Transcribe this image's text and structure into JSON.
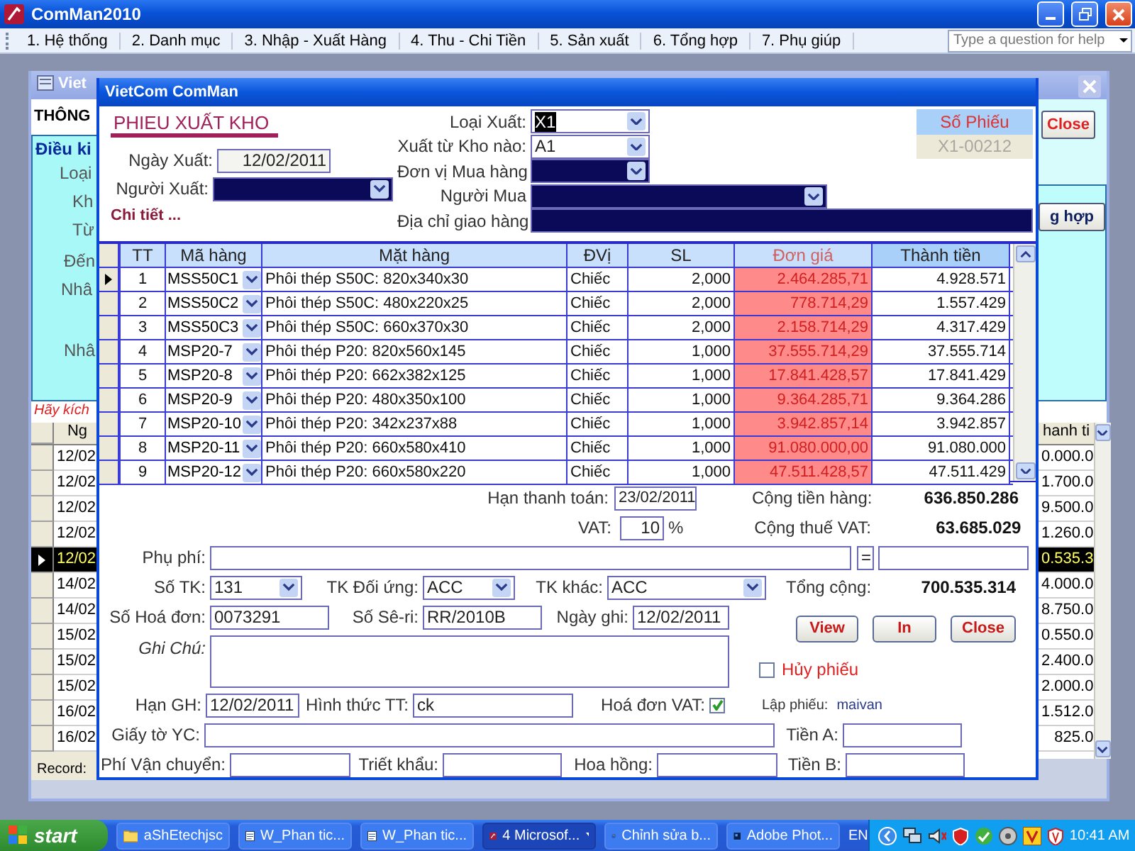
{
  "app": {
    "title": "ComMan2010",
    "menu": [
      "1. Hệ thống",
      "2. Danh mục",
      "3. Nhập - Xuất Hàng",
      "4. Thu - Chi Tiền",
      "5. Sản xuất",
      "6. Tổng hợp",
      "7. Phụ giúp"
    ],
    "help": {
      "placeholder": "Type a question for help"
    }
  },
  "background_window": {
    "title": "Viet",
    "heading": "THÔNG",
    "filter_title": "Điều ki",
    "filter_labels": [
      "Loại",
      "Kh",
      "Từ",
      "Đến",
      "Nhâ",
      "Nhâ"
    ],
    "hint": "Hãy kích",
    "buttons": [
      "Close",
      "g hợp"
    ],
    "grid": {
      "columns": [
        "Ng",
        "hanh ti"
      ],
      "rows": [
        {
          "date": "12/02",
          "amount": "0.000.0",
          "selected": false
        },
        {
          "date": "12/02",
          "amount": "1.700.0",
          "selected": false
        },
        {
          "date": "12/02",
          "amount": "9.500.0",
          "selected": false
        },
        {
          "date": "12/02",
          "amount": "1.260.0",
          "selected": false
        },
        {
          "date": "12/02",
          "amount": "0.535.3",
          "selected": true
        },
        {
          "date": "14/02",
          "amount": "4.000.0",
          "selected": false
        },
        {
          "date": "14/02",
          "amount": "8.750.0",
          "selected": false
        },
        {
          "date": "15/02",
          "amount": "0.550.0",
          "selected": false
        },
        {
          "date": "15/02",
          "amount": "2.400.0",
          "selected": false
        },
        {
          "date": "15/02",
          "amount": "2.000.0",
          "selected": false
        },
        {
          "date": "16/02",
          "amount": "1.512.0",
          "selected": false
        },
        {
          "date": "16/02",
          "amount": "825.0",
          "selected": false
        }
      ]
    },
    "record_label": "Record:"
  },
  "form": {
    "title": "VietCom ComMan",
    "heading": "PHIEU XUẤT KHO",
    "export_date": {
      "label": "Ngày Xuất:",
      "value": "12/02/2011"
    },
    "issuer": {
      "label": "Người Xuất:"
    },
    "details_link": "Chi tiết ...",
    "header_fields": [
      {
        "label": "Loại Xuất:",
        "kind": "combo",
        "value": "X1",
        "highlighted": true
      },
      {
        "label": "Xuất từ Kho nào:",
        "kind": "combo",
        "value": "A1",
        "highlighted": false
      },
      {
        "label": "Đơn vị Mua hàng",
        "kind": "redacted_combo",
        "highlighted": false
      },
      {
        "label": "Người Mua",
        "kind": "redacted_combo",
        "highlighted": false
      },
      {
        "label": "Địa chỉ giao hàng",
        "kind": "redacted_text",
        "highlighted": false
      }
    ],
    "voucher": {
      "label": "Số Phiếu",
      "value": "X1-00212"
    },
    "table": {
      "columns": [
        "TT",
        "Mã hàng",
        "Mặt hàng",
        "ĐVị",
        "SL",
        "Đơn giá",
        "Thành tiền"
      ],
      "rows": [
        {
          "current": true,
          "tt": "1",
          "code": "MSS50C1",
          "name": "Phôi thép S50C: 820x340x30",
          "unit": "Chiếc",
          "qty": "2,000",
          "price": "2.464.285,71",
          "amount": "4.928.571"
        },
        {
          "current": false,
          "tt": "2",
          "code": "MSS50C2",
          "name": "Phôi thép S50C: 480x220x25",
          "unit": "Chiếc",
          "qty": "2,000",
          "price": "778.714,29",
          "amount": "1.557.429"
        },
        {
          "current": false,
          "tt": "3",
          "code": "MSS50C3",
          "name": "Phôi thép S50C: 660x370x30",
          "unit": "Chiếc",
          "qty": "2,000",
          "price": "2.158.714,29",
          "amount": "4.317.429"
        },
        {
          "current": false,
          "tt": "4",
          "code": "MSP20-7",
          "name": "Phôi thép P20: 820x560x145",
          "unit": "Chiếc",
          "qty": "1,000",
          "price": "37.555.714,29",
          "amount": "37.555.714"
        },
        {
          "current": false,
          "tt": "5",
          "code": "MSP20-8",
          "name": "Phôi thép P20: 662x382x125",
          "unit": "Chiếc",
          "qty": "1,000",
          "price": "17.841.428,57",
          "amount": "17.841.429"
        },
        {
          "current": false,
          "tt": "6",
          "code": "MSP20-9",
          "name": "Phôi thép P20: 480x350x100",
          "unit": "Chiếc",
          "qty": "1,000",
          "price": "9.364.285,71",
          "amount": "9.364.286"
        },
        {
          "current": false,
          "tt": "7",
          "code": "MSP20-10",
          "name": "Phôi thép P20: 342x237x88",
          "unit": "Chiếc",
          "qty": "1,000",
          "price": "3.942.857,14",
          "amount": "3.942.857"
        },
        {
          "current": false,
          "tt": "8",
          "code": "MSP20-11",
          "name": "Phôi thép P20: 660x580x410",
          "unit": "Chiếc",
          "qty": "1,000",
          "price": "91.080.000,00",
          "amount": "91.080.000"
        },
        {
          "current": false,
          "tt": "9",
          "code": "MSP20-12",
          "name": "Phôi thép P20: 660x580x220",
          "unit": "Chiếc",
          "qty": "1,000",
          "price": "47.511.428,57",
          "amount": "47.511.429"
        }
      ]
    },
    "payment_due": {
      "label": "Hạn thanh toán:",
      "value": "23/02/2011"
    },
    "vat": {
      "label": "VAT:",
      "value": "10",
      "unit": "%"
    },
    "totals": [
      {
        "label": "Cộng tiền hàng:",
        "value": "636.850.286"
      },
      {
        "label": "Cộng thuế VAT:",
        "value": "63.685.029"
      },
      {
        "label": "Tổng cộng:",
        "value": "700.535.314"
      }
    ],
    "surcharge": {
      "label": "Phụ phí:",
      "equals": "="
    },
    "accounts": [
      {
        "label": "Số TK:",
        "value": "131"
      },
      {
        "label": "TK Đối ứng:",
        "value": "ACC"
      },
      {
        "label": "TK khác:",
        "value": "ACC"
      }
    ],
    "invoice_fields": [
      {
        "label": "Số Hoá đơn:",
        "value": "0073291"
      },
      {
        "label": "Số Sê-ri:",
        "value": "RR/2010B"
      },
      {
        "label": "Ngày ghi:",
        "value": "12/02/2011"
      }
    ],
    "buttons": [
      "View",
      "In",
      "Close"
    ],
    "note": {
      "label": "Ghi Chú:"
    },
    "cancel": {
      "label": "Hủy phiếu",
      "checked": false
    },
    "delivery_due": {
      "label": "Hạn GH:",
      "value": "12/02/2011"
    },
    "payment_method": {
      "label": "Hình thức TT:",
      "value": "ck"
    },
    "vat_invoice": {
      "label": "Hoá đơn VAT:",
      "checked": true
    },
    "created_by": {
      "label": "Lập phiếu:",
      "value": "maivan"
    },
    "documents": {
      "label": "Giấy tờ YC:"
    },
    "amount_a": {
      "label": "Tiền A:"
    },
    "shipping": {
      "label": "Phí Vận chuyển:"
    },
    "discount": {
      "label": "Triết khẩu:"
    },
    "commission": {
      "label": "Hoa hồng:"
    },
    "amount_b": {
      "label": "Tiền B:"
    }
  },
  "taskbar": {
    "start": "start",
    "items": [
      {
        "label": "aShEtechjsc",
        "kind": "folder",
        "selected": false,
        "grouped": false
      },
      {
        "label": "W_Phan tic...",
        "kind": "document",
        "selected": false,
        "grouped": false
      },
      {
        "label": "W_Phan tic...",
        "kind": "document",
        "selected": false,
        "grouped": false
      },
      {
        "label": "4 Microsof...",
        "kind": "database",
        "selected": true,
        "grouped": true
      },
      {
        "label": "Chỉnh sửa b...",
        "kind": "browser",
        "selected": false,
        "grouped": false
      },
      {
        "label": "Adobe Phot...",
        "kind": "image_editor",
        "selected": false,
        "grouped": false
      }
    ],
    "language": "EN",
    "clock": "10:41 AM"
  }
}
